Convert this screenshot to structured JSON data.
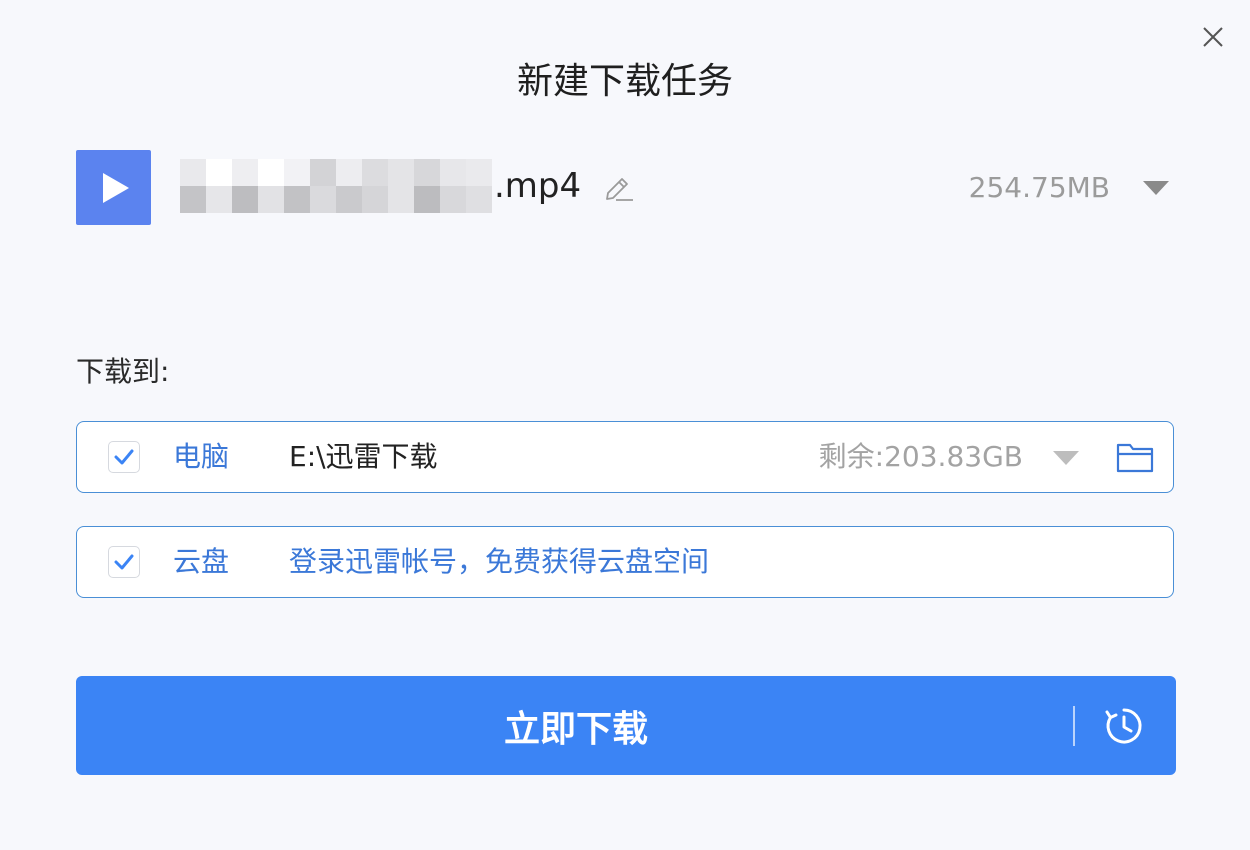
{
  "dialog": {
    "title": "新建下载任务",
    "close_icon": "close-icon"
  },
  "file": {
    "type_icon": "play-icon",
    "name_blurred": true,
    "extension": ".mp4",
    "edit_icon": "pencil-icon",
    "size": "254.75MB",
    "size_dropdown_icon": "triangle-down-icon"
  },
  "destination": {
    "label": "下载到:",
    "pc": {
      "checked": true,
      "name": "电脑",
      "path": "E:\\迅雷下载",
      "free_space": "剩余:203.83GB",
      "dropdown_icon": "triangle-down-icon",
      "folder_icon": "folder-icon"
    },
    "cloud": {
      "checked": true,
      "name": "云盘",
      "login_text": "登录迅雷帐号，免费获得云盘空间"
    }
  },
  "actions": {
    "download_label": "立即下载",
    "schedule_icon": "clock-refresh-icon"
  },
  "colors": {
    "accent": "#3b84f5",
    "link": "#3b78d8",
    "file_icon_bg": "#5b83ef",
    "border": "#4a8fd6"
  }
}
